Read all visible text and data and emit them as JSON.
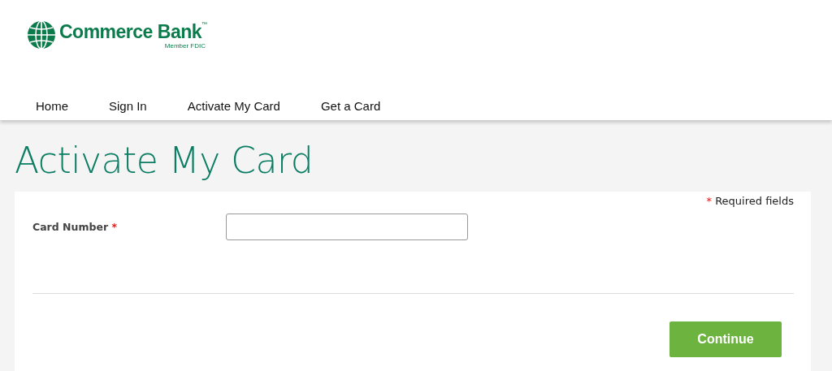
{
  "logo": {
    "name": "Commerce Bank",
    "trademark": "™",
    "tagline": "Member FDIC"
  },
  "nav": [
    "Home",
    "Sign In",
    "Activate My Card",
    "Get a Card"
  ],
  "page_title": "Activate My Card",
  "form": {
    "required_note": {
      "mark": "*",
      "text": "Required fields"
    },
    "fields": [
      {
        "label": "Card Number",
        "required_mark": "*"
      }
    ],
    "submit": "Continue"
  }
}
